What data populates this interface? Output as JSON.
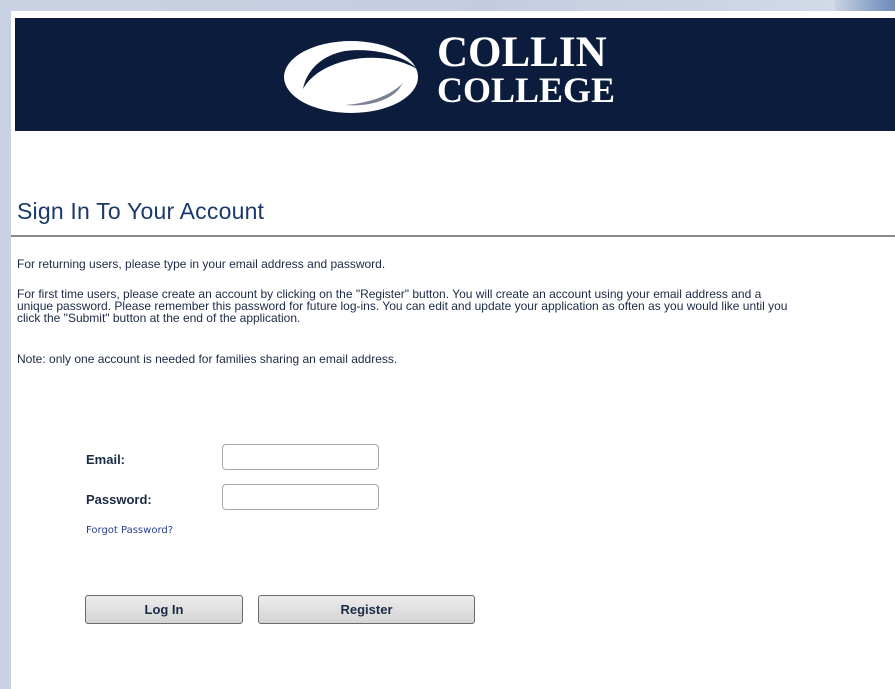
{
  "brand": {
    "line1": "COLLIN",
    "line2": "COLLEGE",
    "banner_color": "#0b1c3d"
  },
  "page": {
    "title": "Sign In To Your Account",
    "paragraphs": [
      "For returning users, please type in your email address and password.",
      "For first time users, please create an account by clicking on the \"Register\" button. You will create an account using your email address and a unique password. Please remember this password for future log-ins. You can edit and update your application as often as you would like until you click the \"Submit\" button at the end of the application.",
      "Note: only one account is needed for families sharing an email address."
    ]
  },
  "form": {
    "email_label": "Email:",
    "email_value": "",
    "password_label": "Password:",
    "password_value": "",
    "forgot_link": "Forgot Password?",
    "login_button": "Log In",
    "register_button": "Register"
  }
}
